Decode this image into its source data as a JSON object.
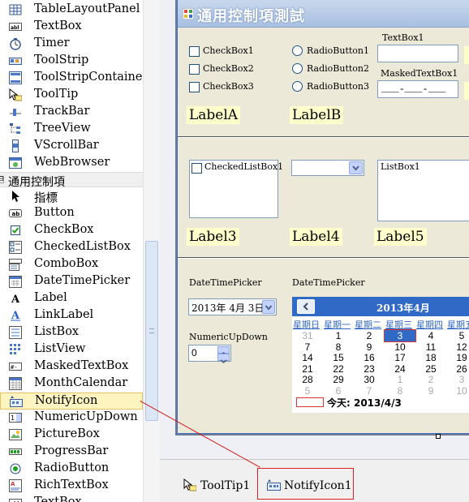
{
  "toolbox": {
    "items_top": [
      {
        "label": "TableLayoutPanel",
        "icon": "table-layout-panel-icon"
      },
      {
        "label": "TextBox",
        "icon": "textbox-icon"
      },
      {
        "label": "Timer",
        "icon": "timer-icon"
      },
      {
        "label": "ToolStrip",
        "icon": "toolstrip-icon"
      },
      {
        "label": "ToolStripContainer",
        "icon": "toolstrip-container-icon"
      },
      {
        "label": "ToolTip",
        "icon": "tooltip-icon"
      },
      {
        "label": "TrackBar",
        "icon": "trackbar-icon"
      },
      {
        "label": "TreeView",
        "icon": "treeview-icon"
      },
      {
        "label": "VScrollBar",
        "icon": "vscrollbar-icon"
      },
      {
        "label": "WebBrowser",
        "icon": "webbrowser-icon"
      }
    ],
    "category": {
      "label": "通用控制項",
      "expander": "⊟"
    },
    "items": [
      {
        "label": "指標",
        "icon": "pointer-icon"
      },
      {
        "label": "Button",
        "icon": "button-icon"
      },
      {
        "label": "CheckBox",
        "icon": "checkbox-icon"
      },
      {
        "label": "CheckedListBox",
        "icon": "checked-listbox-icon"
      },
      {
        "label": "ComboBox",
        "icon": "combobox-icon"
      },
      {
        "label": "DateTimePicker",
        "icon": "datetimepicker-icon"
      },
      {
        "label": "Label",
        "icon": "label-icon"
      },
      {
        "label": "LinkLabel",
        "icon": "linklabel-icon"
      },
      {
        "label": "ListBox",
        "icon": "listbox-icon"
      },
      {
        "label": "ListView",
        "icon": "listview-icon"
      },
      {
        "label": "MaskedTextBox",
        "icon": "maskedtextbox-icon"
      },
      {
        "label": "MonthCalendar",
        "icon": "monthcalendar-icon"
      },
      {
        "label": "NotifyIcon",
        "icon": "notifyicon-icon",
        "selected": true
      },
      {
        "label": "NumericUpDown",
        "icon": "numericupdown-icon"
      },
      {
        "label": "PictureBox",
        "icon": "picturebox-icon"
      },
      {
        "label": "ProgressBar",
        "icon": "progressbar-icon"
      },
      {
        "label": "RadioButton",
        "icon": "radiobutton-icon"
      },
      {
        "label": "RichTextBox",
        "icon": "richtextbox-icon"
      },
      {
        "label": "TextBox",
        "icon": "textbox-icon"
      }
    ]
  },
  "form": {
    "title": "通用控制項測試",
    "checkboxes": [
      "CheckBox1",
      "CheckBox2",
      "CheckBox3"
    ],
    "radios": [
      "RadioButton1",
      "RadioButton2",
      "RadioButton3"
    ],
    "textbox_label": "TextBox1",
    "masked_label": "MaskedTextBox1",
    "masked_value": "___-___-___",
    "labelA": "LabelA",
    "labelB": "LabelB",
    "checkedlistbox": "CheckedListBox1",
    "listbox": "ListBox1",
    "label3": "Label3",
    "label4": "Label4",
    "label5": "Label5",
    "dtp_label1": "DateTimePicker",
    "dtp_label2": "DateTimePicker",
    "dtp_value": "2013年 4月 3日",
    "numeric_label": "NumericUpDown",
    "numeric_value": "0"
  },
  "calendar": {
    "month": "2013年4月",
    "weekdays": [
      "星期日",
      "星期一",
      "星期二",
      "星期三",
      "星期四",
      "星期五"
    ],
    "rows": [
      [
        "31",
        "1",
        "2",
        "3",
        "4",
        "5"
      ],
      [
        "7",
        "8",
        "9",
        "10",
        "11",
        "12"
      ],
      [
        "14",
        "15",
        "16",
        "17",
        "18",
        "19"
      ],
      [
        "21",
        "22",
        "23",
        "24",
        "25",
        "26"
      ],
      [
        "28",
        "29",
        "30",
        "1",
        "2",
        "3"
      ],
      [
        "5",
        "6",
        "7",
        "8",
        "9",
        "10"
      ]
    ],
    "today_label": "今天: 2013/4/3"
  },
  "tray": {
    "items": [
      {
        "label": "ToolTip1",
        "icon": "tooltip-icon"
      },
      {
        "label": "NotifyIcon1",
        "icon": "notifyicon-icon"
      }
    ]
  }
}
